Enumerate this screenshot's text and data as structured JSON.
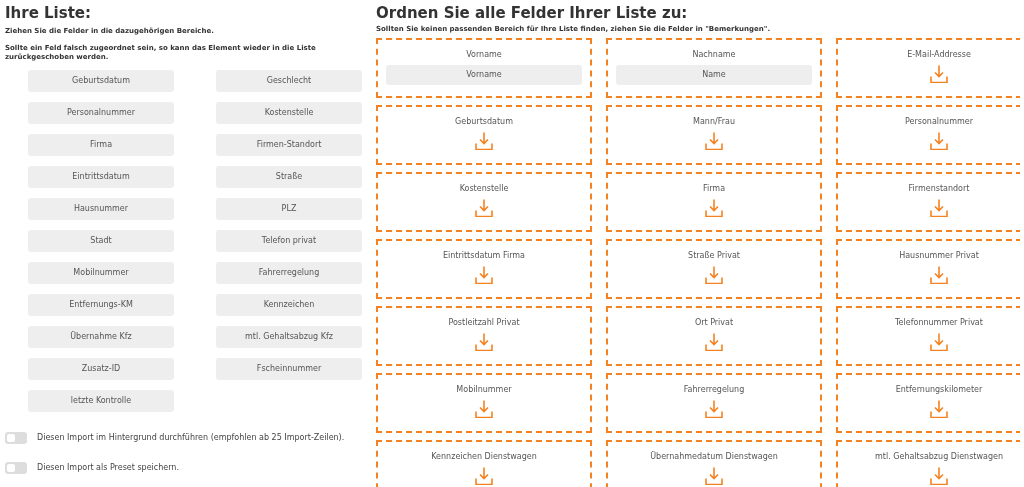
{
  "list_panel": {
    "title": "Ihre Liste:",
    "instruction": "Ziehen Sie die Felder in die dazugehörigen Bereiche.",
    "note": "Sollte ein Feld falsch zugeordnet sein, so kann das Element wieder in die Liste zurückgeschoben werden.",
    "fields": [
      "Geburtsdatum",
      "Geschlecht",
      "Personalnummer",
      "Kostenstelle",
      "Firma",
      "Firmen-Standort",
      "Eintrittsdatum",
      "Straße",
      "Hausnummer",
      "PLZ",
      "Stadt",
      "Telefon privat",
      "Mobilnummer",
      "Fahrerregelung",
      "Entfernungs-KM",
      "Kennzeichen",
      "Übernahme Kfz",
      "mtl. Gehaltsabzug Kfz",
      "Zusatz-ID",
      "Fscheinnummer",
      "letzte Kontrolle"
    ],
    "options": [
      {
        "label": "Diesen Import im Hintergrund durchführen (empfohlen ab 25 Import-Zeilen).",
        "on": false
      },
      {
        "label": "Diesen Import als Preset speichern.",
        "on": false
      }
    ]
  },
  "mapping_panel": {
    "title": "Ordnen Sie alle Felder Ihrer Liste zu:",
    "instruction": "Sollten Sie keinen passenden Bereich für Ihre Liste finden, ziehen Sie die Felder in \"Bemerkungen\".",
    "zones": [
      {
        "label": "Vorname",
        "assigned": "Vorname"
      },
      {
        "label": "Nachname",
        "assigned": "Name"
      },
      {
        "label": "E-Mail-Addresse"
      },
      {
        "label": "Geburtsdatum"
      },
      {
        "label": "Mann/Frau"
      },
      {
        "label": "Personalnummer"
      },
      {
        "label": "Kostenstelle"
      },
      {
        "label": "Firma"
      },
      {
        "label": "Firmenstandort"
      },
      {
        "label": "Eintrittsdatum Firma"
      },
      {
        "label": "Straße Privat"
      },
      {
        "label": "Hausnummer Privat"
      },
      {
        "label": "Postleitzahl Privat"
      },
      {
        "label": "Ort Privat"
      },
      {
        "label": "Telefonnummer Privat"
      },
      {
        "label": "Mobilnummer"
      },
      {
        "label": "Fahrerregelung"
      },
      {
        "label": "Entfernungskilometer"
      },
      {
        "label": "Kennzeichen Dienstwagen"
      },
      {
        "label": "Übernahmedatum Dienstwagen"
      },
      {
        "label": "mtl. Gehaltsabzug Dienstwagen"
      }
    ]
  }
}
